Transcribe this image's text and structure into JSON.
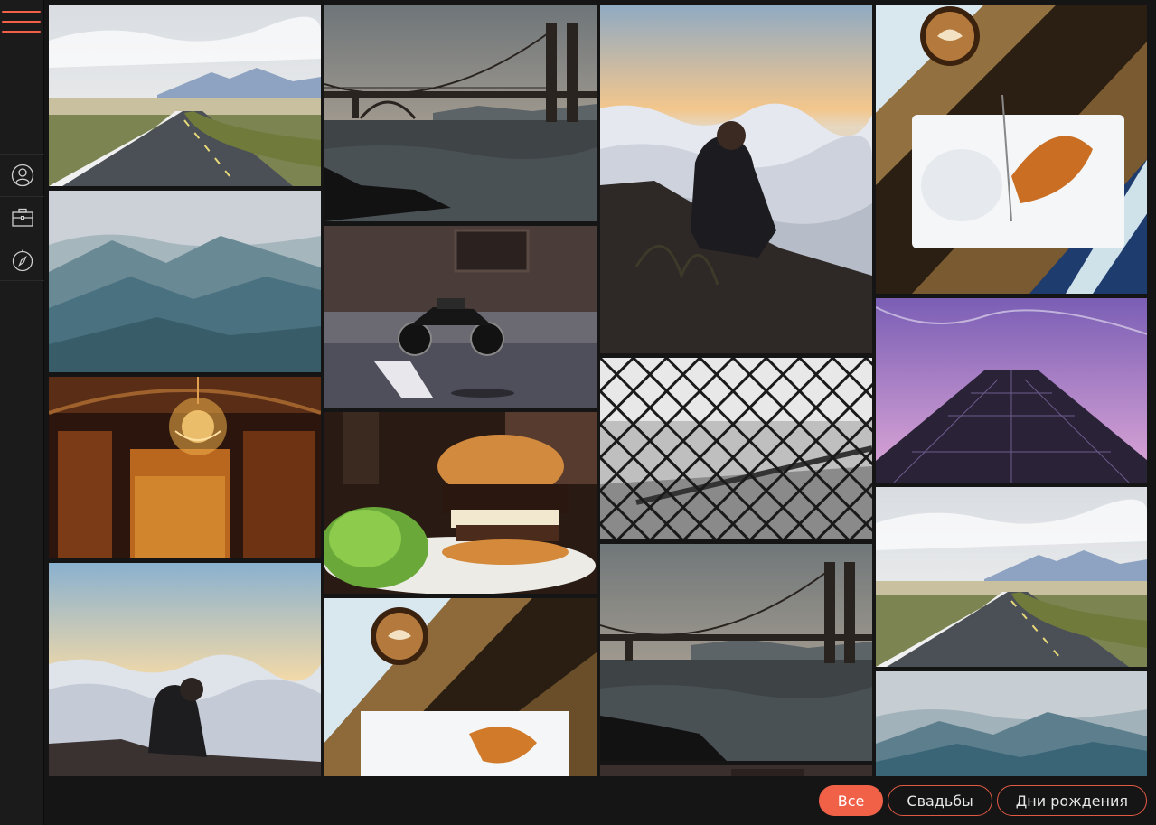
{
  "sidebar": {
    "menu_icon": "hamburger-menu-icon",
    "items": [
      {
        "icon": "user-icon"
      },
      {
        "icon": "briefcase-icon"
      },
      {
        "icon": "compass-icon"
      }
    ]
  },
  "gallery": {
    "photos": [
      {
        "subject": "road-through-hills"
      },
      {
        "subject": "misty-mountains"
      },
      {
        "subject": "chandelier-theater"
      },
      {
        "subject": "man-above-clouds"
      },
      {
        "subject": "golden-gate-bridge"
      },
      {
        "subject": "motorcycle-street"
      },
      {
        "subject": "burger-plate"
      },
      {
        "subject": "coffee-and-cake"
      },
      {
        "subject": "man-above-clouds"
      },
      {
        "subject": "chain-link-fence"
      },
      {
        "subject": "golden-gate-bridge"
      },
      {
        "subject": "coffee-and-cake"
      },
      {
        "subject": "skyscraper-purple-sky"
      },
      {
        "subject": "road-through-hills"
      },
      {
        "subject": "misty-mountains"
      }
    ]
  },
  "filters": {
    "all": "Все",
    "weddings": "Свадьбы",
    "birthdays": "Дни рождения",
    "active": "all"
  },
  "colors": {
    "accent": "#f06148",
    "background": "#151515",
    "sidebar": "#1b1b1b"
  }
}
